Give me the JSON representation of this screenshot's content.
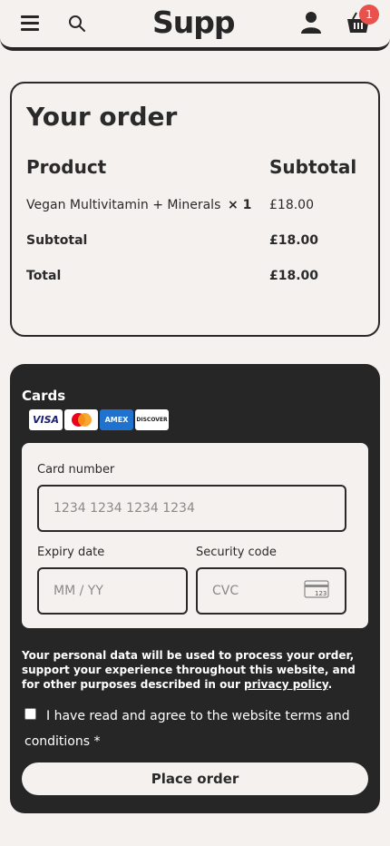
{
  "header": {
    "logo": "Supp",
    "cart_count": "1",
    "icons": [
      "menu-icon",
      "search-icon",
      "user-icon",
      "cart-icon"
    ]
  },
  "order": {
    "title": "Your order",
    "col_product": "Product",
    "col_subtotal": "Subtotal",
    "item_name": "Vegan Multivitamin + Minerals",
    "item_qty": "× 1",
    "item_price": "£18.00",
    "subtotal_label": "Subtotal",
    "subtotal_value": "£18.00",
    "total_label": "Total",
    "total_value": "£18.00"
  },
  "payment": {
    "method_title": "Cards",
    "brands": [
      "VISA",
      "Mastercard",
      "AMEX",
      "DISCOVER"
    ],
    "card_number_label": "Card number",
    "card_number_placeholder": "1234 1234 1234 1234",
    "expiry_label": "Expiry date",
    "expiry_placeholder": "MM / YY",
    "cvc_label": "Security code",
    "cvc_placeholder": "CVC",
    "cvc_icon_text": "123"
  },
  "privacy": {
    "text": "Your personal data will be used to process your order, support your experience throughout this website, and for other purposes described in our ",
    "link": "privacy policy",
    "end": "."
  },
  "terms": {
    "text": "I have read and agree to the website terms and conditions ",
    "required": "*"
  },
  "place_order": "Place order",
  "colors": {
    "background": "#f4f1ef",
    "dark": "#262626",
    "badge": "#e8514c"
  }
}
